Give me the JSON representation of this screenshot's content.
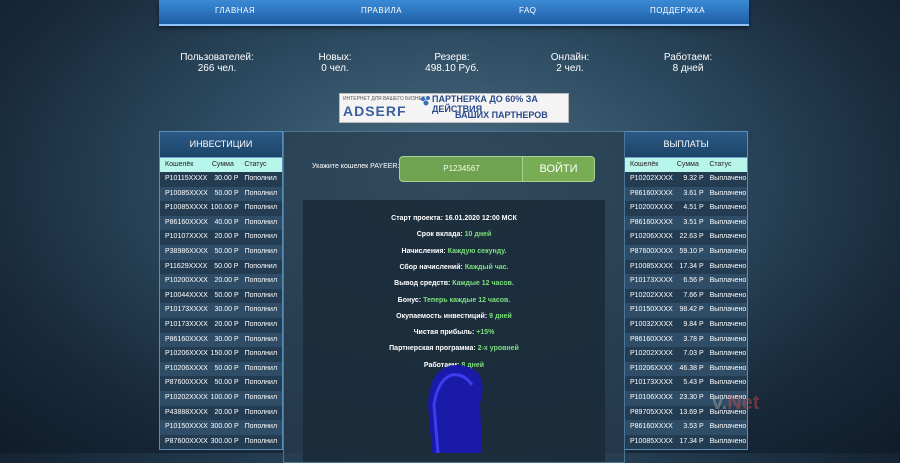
{
  "nav": {
    "items": [
      "ГЛАВНАЯ",
      "ПРАВИЛА",
      "FAQ",
      "ПОДДЕРЖКА"
    ]
  },
  "stats": [
    {
      "label": "Пользователей:",
      "value": "266 чел."
    },
    {
      "label": "Новых:",
      "value": "0 чел."
    },
    {
      "label": "Резерв:",
      "value": "498.10 Руб."
    },
    {
      "label": "Онлайн:",
      "value": "2 чел."
    },
    {
      "label": "Работаем:",
      "value": "8 дней"
    }
  ],
  "banner": {
    "brand": "ADSERF",
    "small": "ИНТЕРНЕТ ДЛЯ ВАШЕГО БИЗНЕСА",
    "line1": "ПАРТНЕРКА ДО 60% ЗА ДЕЙСТВИЯ",
    "line2": "ВАШИХ ПАРТНЕРОВ"
  },
  "investments": {
    "title": "ИНВЕСТИЦИИ",
    "headers": [
      "Кошелёк",
      "Сумма",
      "Статус"
    ],
    "rows": [
      [
        "P10115XXXX",
        "30.00 P",
        "Пополнил"
      ],
      [
        "P10085XXXX",
        "50.00 P",
        "Пополнил"
      ],
      [
        "P10085XXXX",
        "100.00 P",
        "Пополнил"
      ],
      [
        "P86160XXXX",
        "40.00 P",
        "Пополнил"
      ],
      [
        "P10107XXXX",
        "20.00 P",
        "Пополнил"
      ],
      [
        "P38986XXXX",
        "50.00 P",
        "Пополнил"
      ],
      [
        "P11629XXXX",
        "50.00 P",
        "Пополнил"
      ],
      [
        "P10200XXXX",
        "20.00 P",
        "Пополнил"
      ],
      [
        "P10044XXXX",
        "50.00 P",
        "Пополнил"
      ],
      [
        "P10173XXXX",
        "30.00 P",
        "Пополнил"
      ],
      [
        "P10173XXXX",
        "20.00 P",
        "Пополнил"
      ],
      [
        "P86160XXXX",
        "30.00 P",
        "Пополнил"
      ],
      [
        "P10206XXXX",
        "150.00 P",
        "Пополнил"
      ],
      [
        "P10206XXXX",
        "50.00 P",
        "Пополнил"
      ],
      [
        "P87600XXXX",
        "50.00 P",
        "Пополнил"
      ],
      [
        "P10202XXXX",
        "100.00 P",
        "Пополнил"
      ],
      [
        "P43888XXXX",
        "20.00 P",
        "Пополнил"
      ],
      [
        "P10150XXXX",
        "300.00 P",
        "Пополнил"
      ],
      [
        "P87600XXXX",
        "300.00 P",
        "Пополнил"
      ]
    ]
  },
  "payouts": {
    "title": "ВЫПЛАТЫ",
    "headers": [
      "Кошелёк",
      "Сумма",
      "Статус"
    ],
    "rows": [
      [
        "P10202XXXX",
        "9.32 P",
        "Выплачено"
      ],
      [
        "P86160XXXX",
        "3.61 P",
        "Выплачено"
      ],
      [
        "P10200XXXX",
        "4.51 P",
        "Выплачено"
      ],
      [
        "P86160XXXX",
        "3.51 P",
        "Выплачено"
      ],
      [
        "P10206XXXX",
        "22.63 P",
        "Выплачено"
      ],
      [
        "P87600XXXX",
        "59.10 P",
        "Выплачено"
      ],
      [
        "P10085XXXX",
        "17.34 P",
        "Выплачено"
      ],
      [
        "P10173XXXX",
        "6.56 P",
        "Выплачено"
      ],
      [
        "P10202XXXX",
        "7.66 P",
        "Выплачено"
      ],
      [
        "P10150XXXX",
        "98.42 P",
        "Выплачено"
      ],
      [
        "P10032XXXX",
        "9.84 P",
        "Выплачено"
      ],
      [
        "P86160XXXX",
        "3.78 P",
        "Выплачено"
      ],
      [
        "P10202XXXX",
        "7.03 P",
        "Выплачено"
      ],
      [
        "P10206XXXX",
        "46.38 P",
        "Выплачено"
      ],
      [
        "P10173XXXX",
        "5.43 P",
        "Выплачено"
      ],
      [
        "P10106XXXX",
        "23.30 P",
        "Выплачено"
      ],
      [
        "P89705XXXX",
        "13.69 P",
        "Выплачено"
      ],
      [
        "P86160XXXX",
        "3.53 P",
        "Выплачено"
      ],
      [
        "P10085XXXX",
        "17.34 P",
        "Выплачено"
      ]
    ]
  },
  "login": {
    "label": "Укажите кошелек PAYEER:",
    "value": "P1234567",
    "button": "ВОЙТИ"
  },
  "info": [
    {
      "label": "Старт проекта:",
      "value": "16.01.2020 12:00 МСК",
      "accent": false
    },
    {
      "label": "Срок вклада:",
      "value": "10 дней",
      "accent": true
    },
    {
      "label": "Начисления:",
      "value": "Каждую секунду.",
      "accent": true
    },
    {
      "label": "Сбор начислений:",
      "value": "Каждый час.",
      "accent": true
    },
    {
      "label": "Вывод средств:",
      "value": "Каждые 12 часов.",
      "accent": true
    },
    {
      "label": "Бонус:",
      "value": "Теперь каждые 12 часов.",
      "accent": true
    },
    {
      "label": "Окупаемость инвестиций:",
      "value": "9 дней",
      "accent": true
    },
    {
      "label": "Чистая прибыль:",
      "value": "+15%",
      "accent": true
    },
    {
      "label": "Партнерская программа:",
      "value": "2-х уровней",
      "accent": true
    },
    {
      "label": "Работаем:",
      "value": "8 дней",
      "accent": true
    }
  ],
  "watermark": {
    "text": "v.",
    "brand": "Net"
  },
  "colors": {
    "nav": "#2a76c4",
    "table_header": "#b8f5ea",
    "accent_green": "#7de07d",
    "button": "#78ad55"
  }
}
